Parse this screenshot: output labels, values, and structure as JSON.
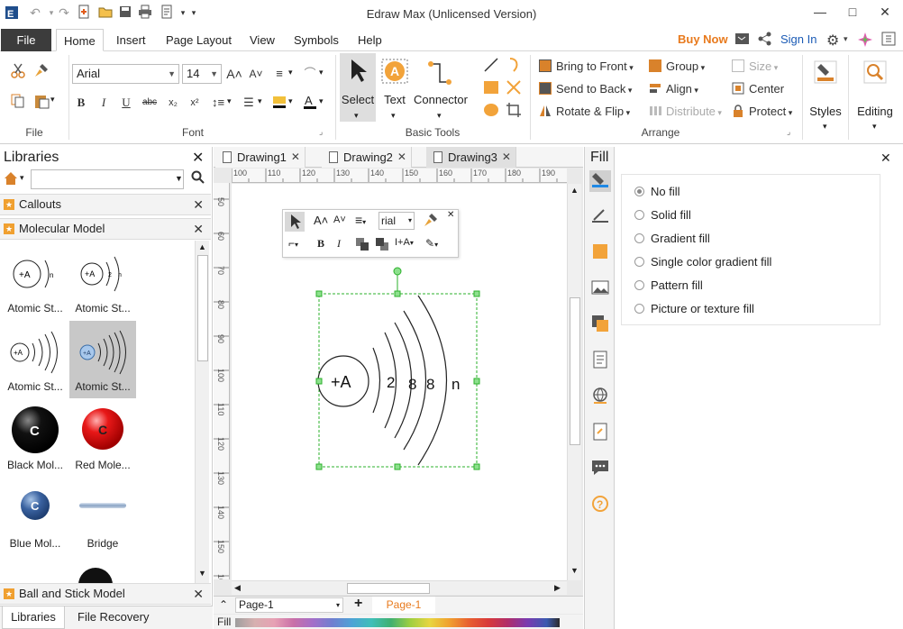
{
  "app": {
    "title": "Edraw Max (Unlicensed Version)",
    "window_controls": [
      "—",
      "□",
      "✕"
    ]
  },
  "quick_access": {
    "icons": [
      "edraw-logo-icon",
      "undo-icon",
      "redo-icon",
      "new-icon",
      "open-icon",
      "save-icon",
      "print-icon",
      "export-icon",
      "customize-icon"
    ]
  },
  "menu": {
    "file": "File",
    "tabs": [
      "Home",
      "Insert",
      "Page Layout",
      "View",
      "Symbols",
      "Help"
    ],
    "active": "Home",
    "buy_now": "Buy Now",
    "sign_in": "Sign In"
  },
  "ribbon": {
    "groups": {
      "file": "File",
      "font": "Font",
      "basic_tools": "Basic Tools",
      "arrange": "Arrange"
    },
    "font": {
      "family": "Arial",
      "size": "14",
      "bold": "B",
      "italic": "I",
      "underline": "U",
      "strike": "abc",
      "subscript": "x₂",
      "superscript": "x²",
      "grow": "A˄",
      "shrink": "A˅"
    },
    "tools": {
      "select": "Select",
      "text": "Text",
      "connector": "Connector"
    },
    "arrange": {
      "bring_front": "Bring to Front",
      "send_back": "Send to Back",
      "rotate_flip": "Rotate & Flip",
      "group": "Group",
      "align": "Align",
      "distribute": "Distribute",
      "size": "Size",
      "center": "Center",
      "protect": "Protect"
    },
    "styles": "Styles",
    "editing": "Editing"
  },
  "libraries": {
    "title": "Libraries",
    "search_placeholder": "",
    "sections": [
      "Callouts",
      "Molecular Model",
      "Ball and Stick Model"
    ],
    "shapes": [
      {
        "label": "Atomic St..."
      },
      {
        "label": "Atomic St..."
      },
      {
        "label": "Atomic St..."
      },
      {
        "label": "Atomic St..."
      },
      {
        "label": "Black Mol..."
      },
      {
        "label": "Red Mole..."
      },
      {
        "label": "Blue Mol..."
      },
      {
        "label": "Bridge"
      }
    ],
    "molecule_letter": "C",
    "atom_label": "+A",
    "bottom_tabs": [
      "Libraries",
      "File Recovery"
    ]
  },
  "documents": {
    "tabs": [
      "Drawing1",
      "Drawing2",
      "Drawing3"
    ],
    "active": "Drawing3"
  },
  "rulers": {
    "h": [
      "100",
      "110",
      "120",
      "130",
      "140",
      "150",
      "160",
      "170",
      "180",
      "190"
    ],
    "v": [
      "50",
      "60",
      "70",
      "80",
      "90",
      "100",
      "110",
      "120",
      "130",
      "140",
      "150",
      "160"
    ]
  },
  "diagram": {
    "nucleus": "+A",
    "shells": [
      "2",
      "8",
      "8",
      "n"
    ]
  },
  "floating_toolbar": {
    "font": "rial"
  },
  "pages": {
    "selector": "Page-1",
    "active_tab": "Page-1",
    "fill_label": "Fill"
  },
  "fill_panel": {
    "title": "Fill",
    "options": [
      {
        "label": "No fill",
        "selected": true
      },
      {
        "label": "Solid fill",
        "selected": false
      },
      {
        "label": "Gradient fill",
        "selected": false
      },
      {
        "label": "Single color gradient fill",
        "selected": false
      },
      {
        "label": "Pattern fill",
        "selected": false
      },
      {
        "label": "Picture or texture fill",
        "selected": false
      }
    ]
  },
  "colors": {
    "accent_orange": "#e87a1d",
    "file_tab": "#3c3c3c",
    "selection_green": "#2bb02b"
  }
}
